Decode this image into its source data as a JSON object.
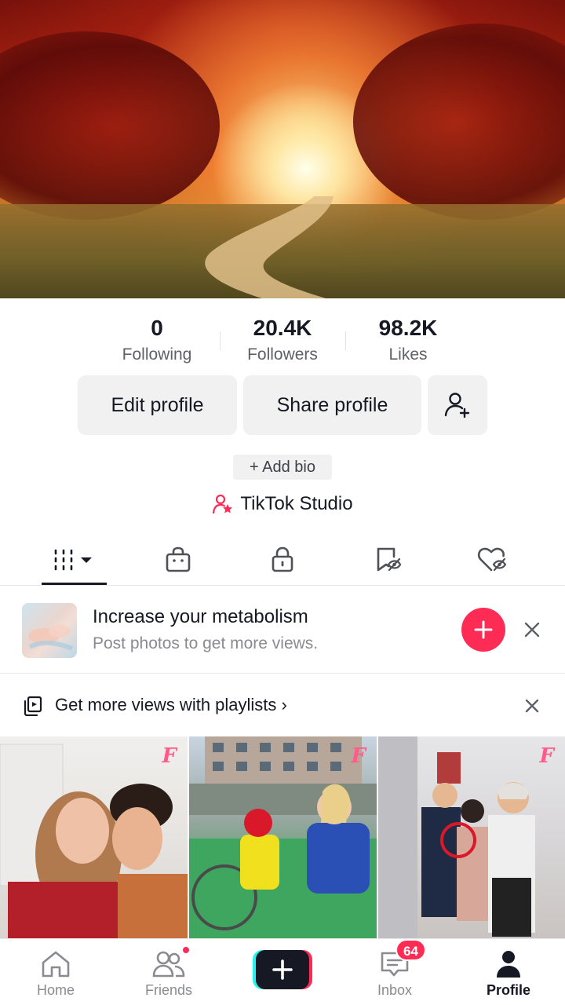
{
  "stats": {
    "following": {
      "value": "0",
      "label": "Following"
    },
    "followers": {
      "value": "20.4K",
      "label": "Followers"
    },
    "likes": {
      "value": "98.2K",
      "label": "Likes"
    }
  },
  "actions": {
    "edit_label": "Edit profile",
    "share_label": "Share profile",
    "add_friend_icon": "add-friend-icon"
  },
  "bio": {
    "add_label": "+ Add bio"
  },
  "studio": {
    "label": "TikTok Studio",
    "icon": "creator-star-icon"
  },
  "tabs": [
    {
      "icon": "videos-grid-icon",
      "active": true
    },
    {
      "icon": "shop-bag-icon"
    },
    {
      "icon": "lock-icon"
    },
    {
      "icon": "favorites-bookmark-icon"
    },
    {
      "icon": "liked-heart-icon"
    }
  ],
  "promo": {
    "title": "Increase your metabolism",
    "subtitle": "Post photos to get more views."
  },
  "playlist": {
    "label": "Get more views with playlists ›"
  },
  "videos": [
    {
      "watermark": "F"
    },
    {
      "watermark": "F"
    },
    {
      "watermark": "F"
    }
  ],
  "nav": {
    "home": "Home",
    "friends": "Friends",
    "inbox": "Inbox",
    "inbox_badge": "64",
    "profile": "Profile"
  },
  "colors": {
    "accent": "#fe2c55",
    "text": "#161823",
    "muted": "#8a8b91",
    "button_bg": "#f1f1f2"
  }
}
